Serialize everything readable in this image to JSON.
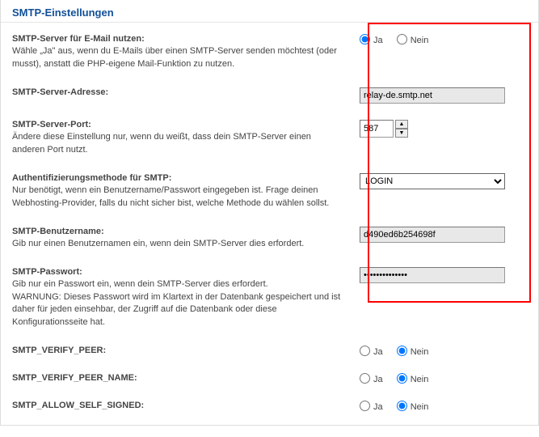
{
  "section_title": "SMTP-Einstellungen",
  "labels": {
    "ja": "Ja",
    "nein": "Nein"
  },
  "rows": {
    "use_smtp": {
      "label": "SMTP-Server für E-Mail nutzen:",
      "desc": "Wähle „Ja\" aus, wenn du E-Mails über einen SMTP-Server senden möchtest (oder musst), anstatt die PHP-eigene Mail-Funktion zu nutzen."
    },
    "server": {
      "label": "SMTP-Server-Adresse:",
      "value": "relay-de.smtp.net"
    },
    "port": {
      "label": "SMTP-Server-Port:",
      "desc": "Ändere diese Einstellung nur, wenn du weißt, dass dein SMTP-Server einen anderen Port nutzt.",
      "value": "587"
    },
    "auth": {
      "label": "Authentifizierungsmethode für SMTP:",
      "desc": "Nur benötigt, wenn ein Benutzername/Passwort eingegeben ist. Frage deinen Webhosting-Provider, falls du nicht sicher bist, welche Methode du wählen sollst.",
      "value": "LOGIN"
    },
    "user": {
      "label": "SMTP-Benutzername:",
      "desc": "Gib nur einen Benutzernamen ein, wenn dein SMTP-Server dies erfordert.",
      "value": "d490ed6b254698f"
    },
    "pass": {
      "label": "SMTP-Passwort:",
      "desc1": "Gib nur ein Passwort ein, wenn dein SMTP-Server dies erfordert.",
      "desc2": "WARNUNG: Dieses Passwort wird im Klartext in der Datenbank gespeichert und ist daher für jeden einsehbar, der Zugriff auf die Datenbank oder diese Konfigurationsseite hat.",
      "value": "••••••••••••••"
    },
    "verify_peer": {
      "label": "SMTP_VERIFY_PEER:"
    },
    "verify_peer_name": {
      "label": "SMTP_VERIFY_PEER_NAME:"
    },
    "allow_self": {
      "label": "SMTP_ALLOW_SELF_SIGNED:"
    }
  }
}
